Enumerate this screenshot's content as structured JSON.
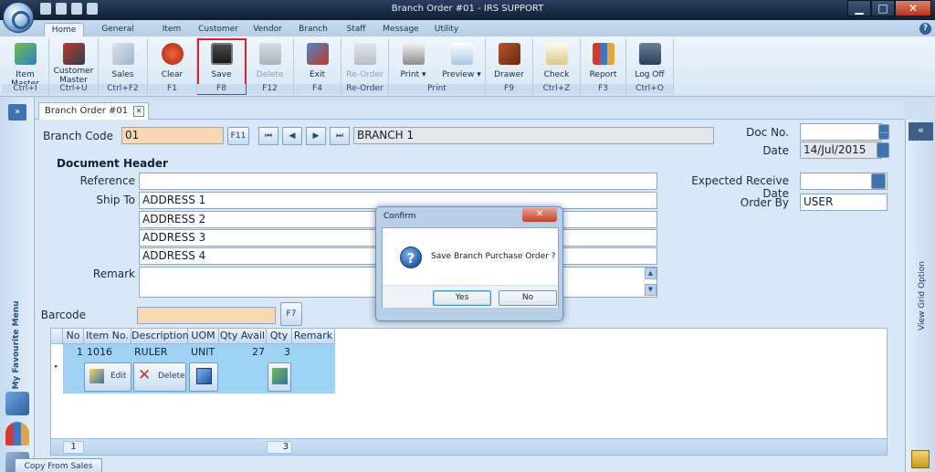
{
  "window": {
    "title": "Branch Order #01 - IRS SUPPORT",
    "minimize": "▁",
    "maximize": "□",
    "close": "✕"
  },
  "ribbon_tabs": [
    "Home",
    "General Setup",
    "Item",
    "Customer",
    "Vendor",
    "Branch",
    "Staff",
    "Message",
    "Utility"
  ],
  "active_tab": "Home",
  "help_label": "?",
  "ribbon": {
    "item_master": {
      "label": "Item Master",
      "shortcut": "Ctrl+I",
      "icon": "item-master-icon"
    },
    "customer_master": {
      "label": "Customer Master",
      "shortcut": "Ctrl+U",
      "icon": "customer-master-icon"
    },
    "sales": {
      "label": "Sales",
      "shortcut": "Ctrl+F2",
      "icon": "sales-icon"
    },
    "clear": {
      "label": "Clear",
      "shortcut": "F1",
      "icon": "clear-icon"
    },
    "save": {
      "label": "Save",
      "shortcut": "F8",
      "icon": "floppy-disk-icon"
    },
    "delete": {
      "label": "Delete",
      "shortcut": "F12",
      "icon": "trash-icon"
    },
    "exit": {
      "label": "Exit",
      "shortcut": "F4",
      "icon": "exit-door-icon"
    },
    "reorder": {
      "label": "Re-Order",
      "shortcut": "Re-Order",
      "icon": "cart-icon"
    },
    "print": {
      "label": "Print",
      "icon": "printer-icon"
    },
    "preview": {
      "label": "Preview",
      "icon": "preview-icon"
    },
    "print_group": "Print",
    "drawer": {
      "label": "Drawer",
      "shortcut": "F9",
      "icon": "drawer-icon"
    },
    "check": {
      "label": "Check",
      "shortcut": "Ctrl+Z",
      "icon": "checklist-icon"
    },
    "report": {
      "label": "Report",
      "shortcut": "F3",
      "icon": "report-icon"
    },
    "logoff": {
      "label": "Log Off",
      "shortcut": "Ctrl+O",
      "icon": "padlock-icon"
    }
  },
  "left_bar": {
    "collapse": "»",
    "label": "My Favourite Menu"
  },
  "right_bar": {
    "collapse": "«",
    "label": "View Grid Option"
  },
  "doc_tab": {
    "label": "Branch Order #01",
    "close": "✕"
  },
  "form": {
    "branch_code_label": "Branch Code",
    "branch_code": "01",
    "f11": "F11",
    "branch_name": "BRANCH 1",
    "nav": {
      "first": "⏮",
      "prev": "◀",
      "next": "▶",
      "last": "⏭"
    },
    "doc_no_label": "Doc No.",
    "doc_no": "",
    "doc_no_btn": "…",
    "date_label": "Date",
    "date": "14/Jul/2015",
    "document_header": "Document Header",
    "reference_label": "Reference",
    "reference": "",
    "ship_to_label": "Ship To",
    "addresses": [
      "ADDRESS 1",
      "ADDRESS 2",
      "ADDRESS 3",
      "ADDRESS 4"
    ],
    "remark_label": "Remark",
    "remark": "",
    "expected_label": "Expected Receive Date",
    "expected": "",
    "order_by_label": "Order By",
    "order_by": "USER",
    "barcode_label": "Barcode",
    "barcode": "",
    "f7": "F7",
    "copy_from_sales": "Copy From Sales"
  },
  "grid": {
    "columns": [
      "No",
      "Item No.",
      "Description",
      "UOM",
      "Qty Avail",
      "Qty",
      "Remark"
    ],
    "rows": [
      {
        "no": "1",
        "item_no": "1016",
        "description": "RULER",
        "uom": "UNIT",
        "qty_avail": "27",
        "qty": "3",
        "remark": ""
      }
    ],
    "edit": "Edit",
    "delete": "Delete",
    "footer": {
      "count": "1",
      "qty_total": "3"
    }
  },
  "dialog": {
    "title": "Confirm",
    "message": "Save Branch Purchase Order ?",
    "yes": "Yes",
    "no": "No",
    "close": "✕"
  },
  "colors": {
    "highlight": "#d8242a",
    "field_peach": "#f8d8b3",
    "row_selected": "#9fd3f6"
  }
}
